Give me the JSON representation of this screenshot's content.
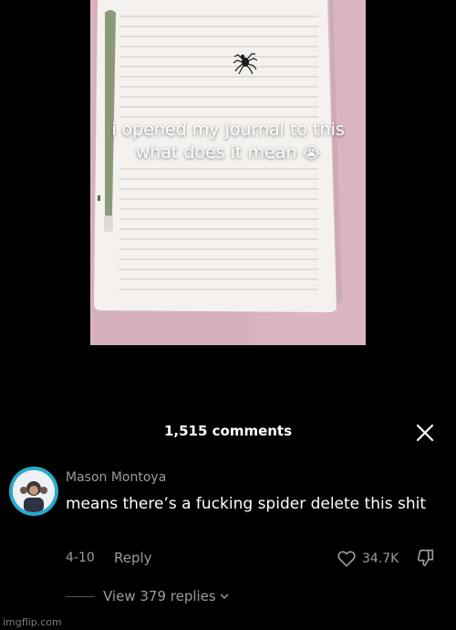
{
  "video": {
    "caption_line1": "i opened my journal to this",
    "caption_line2": "what does it mean",
    "caption_emoji": "😭",
    "background_color": "#d6b1bc",
    "notebook_color": "#f4f1ee"
  },
  "comments": {
    "header_title": "1,515 comments",
    "close_icon": "close-icon"
  },
  "comment": {
    "author": "Mason Montoya",
    "text": "means there’s a fucking spider delete this shit",
    "date": "4-10",
    "reply_label": "Reply",
    "like_count": "34.7K",
    "view_replies_label": "View 379 replies",
    "avatar_ring_color": "#29a9cc"
  },
  "watermark": {
    "text": "imgflip.com"
  }
}
